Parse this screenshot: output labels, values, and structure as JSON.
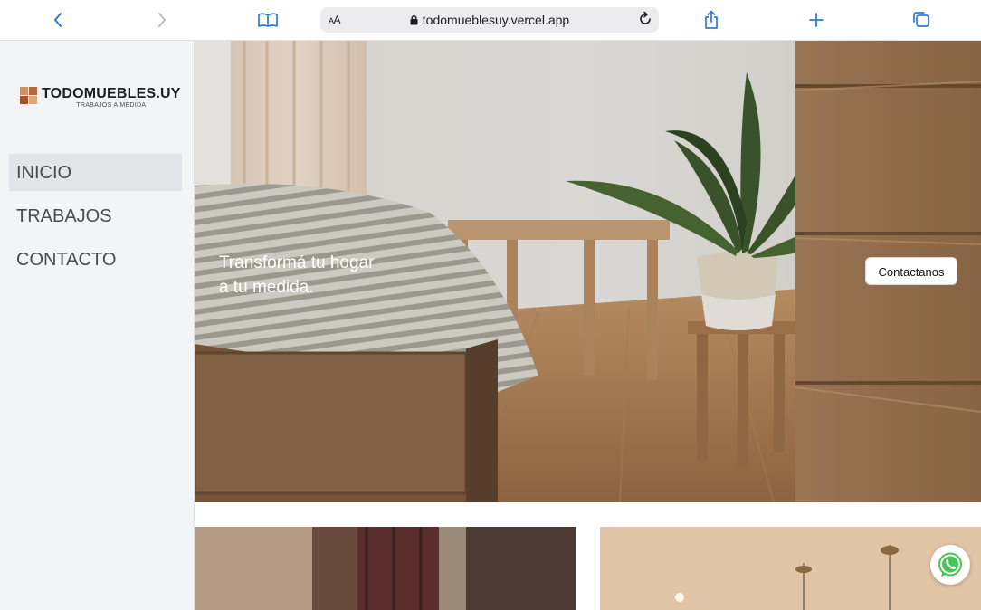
{
  "browser": {
    "reader_label": "AA",
    "url": "todomueblesuy.vercel.app",
    "icons": {
      "back": "chevron-left-icon",
      "forward": "chevron-right-icon",
      "bookmarks": "book-icon",
      "lock": "lock-icon",
      "reload": "reload-icon",
      "share": "share-icon",
      "new_tab": "plus-icon",
      "tabs": "tabs-icon"
    },
    "accent_color": "#2f7bd6"
  },
  "sidebar": {
    "logo": {
      "title": "TODOMUEBLES.UY",
      "subtitle": "TRABAJOS A MEDIDA"
    },
    "nav": [
      {
        "label": "INICIO",
        "active": true
      },
      {
        "label": "TRABAJOS",
        "active": false
      },
      {
        "label": "CONTACTO",
        "active": false
      }
    ]
  },
  "hero": {
    "line1": "Transformá tu hogar",
    "line2": "a tu medida.",
    "cta_label": "Contactanos"
  },
  "floating": {
    "whatsapp_icon": "whatsapp-icon",
    "whatsapp_color": "#45c554"
  }
}
